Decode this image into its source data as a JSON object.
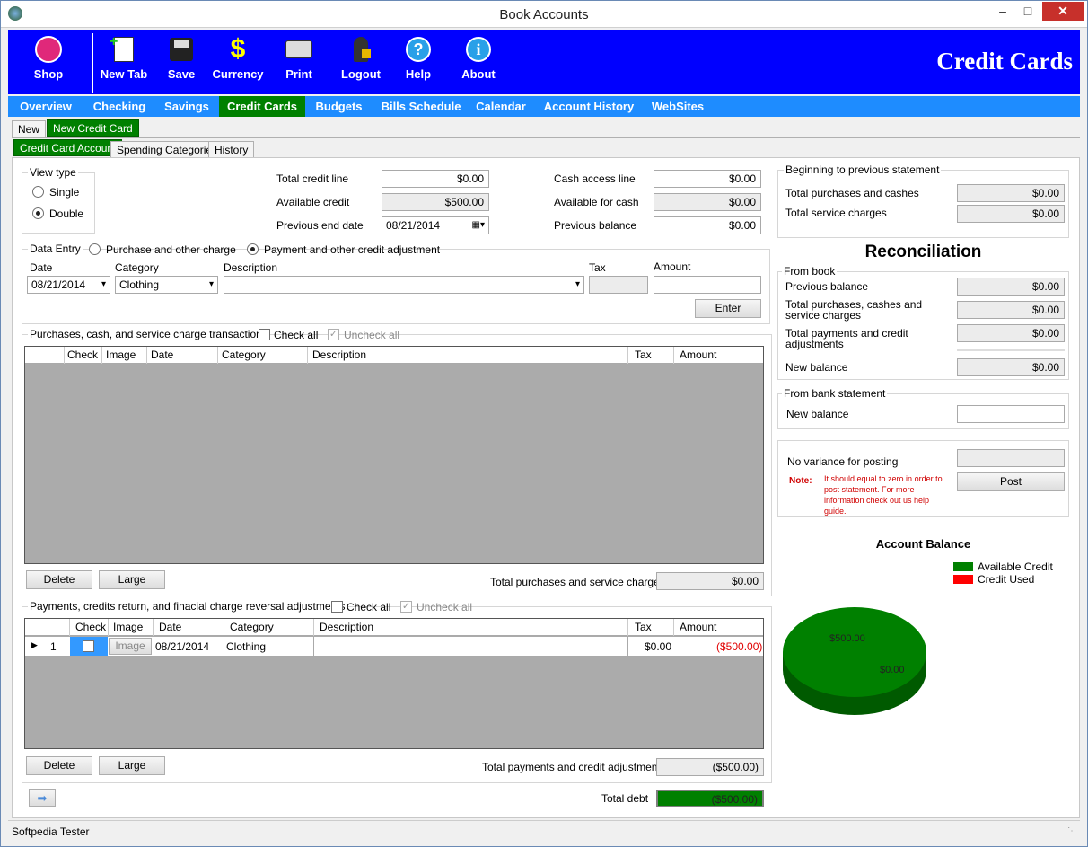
{
  "window": {
    "title": "Book Accounts"
  },
  "toolbar": {
    "buttons": [
      {
        "label": "Shop",
        "icon": "shop-icon"
      },
      {
        "label": "New Tab",
        "icon": "new-tab-icon"
      },
      {
        "label": "Save",
        "icon": "floppy-icon"
      },
      {
        "label": "Currency",
        "icon": "dollar-icon"
      },
      {
        "label": "Print",
        "icon": "printer-icon"
      },
      {
        "label": "Logout",
        "icon": "lock-user-icon"
      },
      {
        "label": "Help",
        "icon": "help-icon"
      },
      {
        "label": "About",
        "icon": "info-icon"
      }
    ],
    "brand": "Credit Cards"
  },
  "nav": {
    "items": [
      "Overview",
      "Checking",
      "Savings",
      "Credit Cards",
      "Budgets",
      "Bills Schedule",
      "Calendar",
      "Account History",
      "WebSites"
    ],
    "active": "Credit Cards"
  },
  "cardtabs": {
    "items": [
      "New",
      "New Credit Card"
    ]
  },
  "subtabs": {
    "items": [
      "Credit Card Account",
      "Spending Categories",
      "History"
    ]
  },
  "viewtype": {
    "legend": "View type",
    "single": "Single",
    "double": "Double"
  },
  "summary": {
    "total_credit_line_label": "Total credit line",
    "total_credit_line": "$0.00",
    "available_credit_label": "Available credit",
    "available_credit": "$500.00",
    "previous_end_date_label": "Previous end date",
    "previous_end_date": "08/21/2014",
    "cash_access_line_label": "Cash access line",
    "cash_access_line": "$0.00",
    "available_for_cash_label": "Available for cash",
    "available_for_cash": "$0.00",
    "previous_balance_label": "Previous balance",
    "previous_balance": "$0.00"
  },
  "entry": {
    "legend": "Data Entry",
    "purchase_label": "Purchase and other charge",
    "payment_label": "Payment and other credit adjustment",
    "date_label": "Date",
    "date": "08/21/2014",
    "category_label": "Category",
    "category": "Clothing",
    "description_label": "Description",
    "tax_label": "Tax",
    "amount_label": "Amount",
    "enter": "Enter"
  },
  "purchases": {
    "legend": "Purchases, cash,  and service charge transactions",
    "check_all": "Check all",
    "uncheck_all": "Uncheck all",
    "columns": [
      "Check",
      "Image",
      "Date",
      "Category",
      "Description",
      "Tax",
      "Amount"
    ],
    "delete": "Delete",
    "large": "Large",
    "total_label": "Total purchases and service charges",
    "total": "$0.00"
  },
  "payments": {
    "legend": "Payments, credits return, and finacial charge reversal adjustments",
    "check_all": "Check all",
    "uncheck_all": "Uncheck all",
    "columns": [
      "Check",
      "Image",
      "Date",
      "Category",
      "Description",
      "Tax",
      "Amount"
    ],
    "rows": [
      {
        "num": "1",
        "image": "Image",
        "date": "08/21/2014",
        "category": "Clothing",
        "description": "",
        "tax": "$0.00",
        "amount": "($500.00)"
      }
    ],
    "delete": "Delete",
    "large": "Large",
    "total_label": "Total payments and credit adjustments",
    "total": "($500.00)"
  },
  "debt": {
    "label": "Total debt",
    "value": "($500.00)"
  },
  "beginning": {
    "legend": "Beginning to previous statement",
    "purchases_label": "Total  purchases and cashes",
    "purchases": "$0.00",
    "service_label": "Total service charges",
    "service": "$0.00"
  },
  "reconciliation": {
    "title": "Reconciliation",
    "from_book": "From book",
    "prev_label": "Previous balance",
    "prev": "$0.00",
    "purch_label": "Total purchases, cashes and service charges",
    "purch": "$0.00",
    "pay_label": "Total payments and credit adjustments",
    "pay": "$0.00",
    "new_label": "New balance",
    "new": "$0.00",
    "from_bank": "From bank statement",
    "bank_new_label": "New balance",
    "bank_new": ""
  },
  "posting": {
    "variance_label": "No variance for posting",
    "variance": "",
    "note_label": "Note:",
    "note": "It should equal to zero in order to post statement. For more information check out us help guide.",
    "post": "Post"
  },
  "chart_data": {
    "type": "pie",
    "title": "Account Balance",
    "categories": [
      "Available Credit",
      "Credit Used"
    ],
    "values": [
      500,
      0
    ],
    "data_labels": [
      "$500.00",
      "$0.00"
    ],
    "colors": [
      "#008000",
      "#ff0000"
    ],
    "legend": "top-right"
  },
  "statusbar": {
    "text": "Softpedia Tester"
  }
}
